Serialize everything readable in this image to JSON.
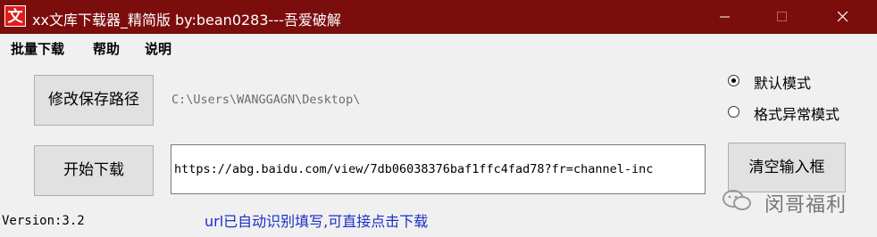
{
  "window": {
    "icon_text": "文",
    "title": "xx文库下载器_精简版  by:bean0283---吾爱破解"
  },
  "menu": [
    "批量下载",
    "帮助",
    "说明"
  ],
  "buttons": {
    "change_path": "修改保存路径",
    "start_download": "开始下载",
    "clear_input": "清空输入框"
  },
  "save_path": "C:\\Users\\WANGGAGN\\Desktop\\",
  "url_input": {
    "value": "https://abg.baidu.com/view/7db06038376baf1ffc4fad78?fr=channel-inc"
  },
  "modes": {
    "default": {
      "label": "默认模式",
      "selected": true
    },
    "abnormal": {
      "label": "格式异常模式",
      "selected": false
    }
  },
  "version": "Version:3.2",
  "hint": "url已自动识别填写,可直接点击下载",
  "watermark": {
    "text": "闵哥福利"
  },
  "colors": {
    "titlebar": "#7c0d0d",
    "hint": "#1a2fc4",
    "path_text": "#6d6d6d"
  }
}
